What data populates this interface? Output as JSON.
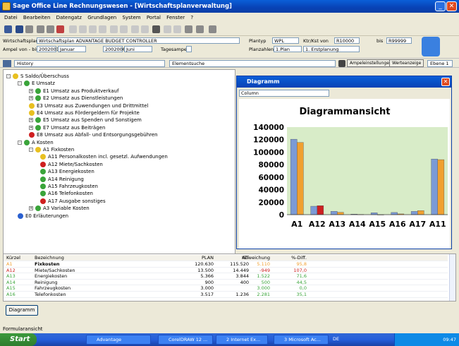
{
  "window": {
    "title": "Sage Office Line Rechnungswesen - [Wirtschaftsplanverwaltung]"
  },
  "menu": [
    "Datei",
    "Bearbeiten",
    "Datengatz",
    "Grundlagen",
    "System",
    "Portal",
    "Fenster",
    "?"
  ],
  "filter": {
    "plan_label": "Wirtschaftsplan",
    "plan_value": "Wirtschaftsplan ADVANTAGE BUDGET CONTROLLER",
    "planty_label": "Plantyp",
    "planty_value": "WPL",
    "ktr_label": "Ktr/Kst von",
    "ktr_value": "R10000",
    "bis_label": "bis",
    "bis_value": "R99999",
    "ampel_label": "Ampel von - bis",
    "ampel_from_year": "2002001",
    "ampel_from_month": "Januar",
    "ampel_to_year": "2002006",
    "ampel_to_month": "Juni",
    "tagesampel_label": "Tagesampel",
    "planzahlen_label": "Planzahlen",
    "planzahlen_value": "1.Plan",
    "erstplanung": "1. Erstplanung"
  },
  "historybar": {
    "history": "History",
    "elementsuche": "Elementsuche",
    "ampel_btn": "Ampeleinstellungen",
    "werte_btn": "Werteanzeige",
    "ebene": "Ebene 1"
  },
  "tree": [
    {
      "label": "S  Saldo/Überschuss",
      "indent": 0,
      "icon": "y",
      "exp": "-"
    },
    {
      "label": "E  Umsatz",
      "indent": 1,
      "icon": "g",
      "exp": "-"
    },
    {
      "label": "E1  Umsatz aus Produktverkauf",
      "indent": 2,
      "icon": "g",
      "exp": "+"
    },
    {
      "label": "E2  Umsatz aus Dienstleistungen",
      "indent": 2,
      "icon": "g",
      "exp": "+"
    },
    {
      "label": "E3  Umsatz aus Zuwendungen und Drittmittel",
      "indent": 2,
      "icon": "y",
      "exp": ""
    },
    {
      "label": "E4  Umsatz aus Fördergeldern für Projekte",
      "indent": 2,
      "icon": "y",
      "exp": ""
    },
    {
      "label": "E5  Umsatz aus Spenden und Sonstigem",
      "indent": 2,
      "icon": "g",
      "exp": "+"
    },
    {
      "label": "E7  Umsatz aus Beiträgen",
      "indent": 2,
      "icon": "g",
      "exp": "+"
    },
    {
      "label": "E8  Umsatz aus Abfall- und Entsorgungsgebühren",
      "indent": 2,
      "icon": "r",
      "exp": ""
    },
    {
      "label": "A  Kosten",
      "indent": 1,
      "icon": "g",
      "exp": "-"
    },
    {
      "label": "A1  Fixkosten",
      "indent": 2,
      "icon": "y",
      "exp": "-"
    },
    {
      "label": "A11  Personalkosten incl. gesetzl. Aufwendungen",
      "indent": 3,
      "icon": "y",
      "exp": ""
    },
    {
      "label": "A12  Miete/Sachkosten",
      "indent": 3,
      "icon": "r",
      "exp": ""
    },
    {
      "label": "A13  Energiekosten",
      "indent": 3,
      "icon": "g",
      "exp": ""
    },
    {
      "label": "A14  Reinigung",
      "indent": 3,
      "icon": "g",
      "exp": ""
    },
    {
      "label": "A15  Fahrzeugkosten",
      "indent": 3,
      "icon": "g",
      "exp": ""
    },
    {
      "label": "A16  Telefonkosten",
      "indent": 3,
      "icon": "g",
      "exp": ""
    },
    {
      "label": "A17  Ausgabe sonstiges",
      "indent": 3,
      "icon": "r",
      "exp": ""
    },
    {
      "label": "A3  Variable Kosten",
      "indent": 2,
      "icon": "g",
      "exp": "+"
    },
    {
      "label": "E0  Erläuterungen",
      "indent": 1,
      "icon": "b",
      "exp": ""
    }
  ],
  "diagram": {
    "title": "Diagramm",
    "chart_type_label": "Column"
  },
  "chart_data": {
    "type": "bar",
    "title": "Diagrammansicht",
    "categories": [
      "A1",
      "A12",
      "A13",
      "A14",
      "A15",
      "A16",
      "A17",
      "A11"
    ],
    "series": [
      {
        "values": [
          120630,
          13500,
          5366,
          900,
          3000,
          3517,
          5200,
          89000
        ]
      },
      {
        "values": [
          115520,
          14449,
          3844,
          400,
          0,
          1236,
          6500,
          88000
        ]
      }
    ],
    "series_colors": [
      "#7b9ad6",
      "#f0a030"
    ],
    "special_color": {
      "A12": "#cc2020"
    },
    "yticks": [
      0,
      20000,
      40000,
      60000,
      80000,
      100000,
      120000,
      140000
    ],
    "ylim": [
      0,
      140000
    ],
    "grid": false,
    "plot_background": "#d8ecc8"
  },
  "table": {
    "headers": [
      "Kürzel",
      "Bezeichnung",
      "PLAN",
      "IST",
      "Abweichung",
      "%-Diff."
    ],
    "rows": [
      {
        "k": "A1",
        "b": "Fixkosten",
        "plan": "120.630",
        "ist": "115.520",
        "abw": "5.110",
        "pct": "95,8",
        "color": "#f0a030",
        "bold": true
      },
      {
        "k": "A12",
        "b": "Miete/Sachkosten",
        "plan": "13.500",
        "ist": "14.449",
        "abw": "-949",
        "pct": "107,0",
        "color": "#cc2020",
        "bold": false
      },
      {
        "k": "A13",
        "b": "Energiekosten",
        "plan": "5.366",
        "ist": "3.844",
        "abw": "1.522",
        "pct": "71,6",
        "color": "#3aa43a",
        "bold": false
      },
      {
        "k": "A14",
        "b": "Reinigung",
        "plan": "900",
        "ist": "400",
        "abw": "500",
        "pct": "44,5",
        "color": "#3aa43a",
        "bold": false
      },
      {
        "k": "A15",
        "b": "Fahrzeugkosten",
        "plan": "3.000",
        "ist": "",
        "abw": "3.000",
        "pct": "0,0",
        "color": "#3aa43a",
        "bold": false
      },
      {
        "k": "A16",
        "b": "Telefonkosten",
        "plan": "3.517",
        "ist": "1.236",
        "abw": "2.281",
        "pct": "35,1",
        "color": "#3aa43a",
        "bold": false
      }
    ]
  },
  "diagram_button": "Diagramm",
  "status": "Formularansicht",
  "taskbar": {
    "start": "Start",
    "tasks": [
      "Advantage",
      "CorelDRAW 12 ...",
      "2 Internet Ex...",
      "3 Microsoft Ac..."
    ],
    "lang": "DE",
    "time": "09:47"
  }
}
